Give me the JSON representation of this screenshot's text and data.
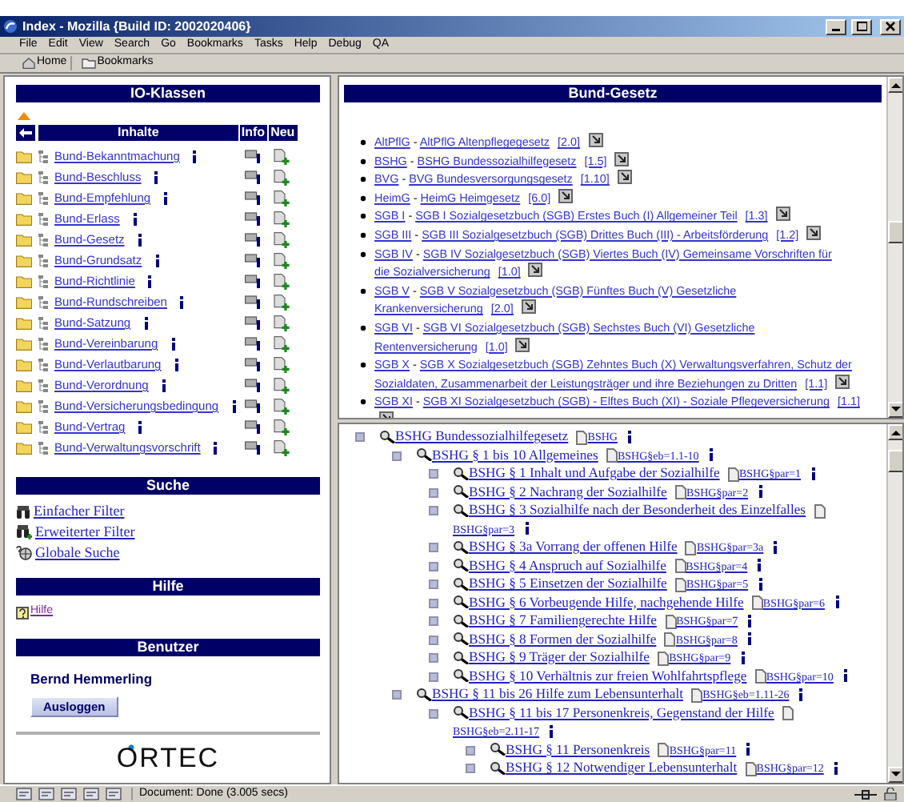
{
  "window": {
    "title": "Index - Mozilla {Build ID: 2002020406}"
  },
  "menu": [
    "File",
    "Edit",
    "View",
    "Search",
    "Go",
    "Bookmarks",
    "Tasks",
    "Help",
    "Debug",
    "QA"
  ],
  "toolbar": [
    "Home",
    "Bookmarks"
  ],
  "io_klassen": {
    "title": "IO-Klassen",
    "columns": [
      "Inhalte",
      "Info",
      "Neu"
    ],
    "rows": [
      {
        "label": "Bund-Bekanntmachung"
      },
      {
        "label": "Bund-Beschluss"
      },
      {
        "label": "Bund-Empfehlung"
      },
      {
        "label": "Bund-Erlass"
      },
      {
        "label": "Bund-Gesetz"
      },
      {
        "label": "Bund-Grundsatz"
      },
      {
        "label": "Bund-Richtlinie"
      },
      {
        "label": "Bund-Rundschreiben"
      },
      {
        "label": "Bund-Satzung"
      },
      {
        "label": "Bund-Vereinbarung"
      },
      {
        "label": "Bund-Verlautbarung"
      },
      {
        "label": "Bund-Verordnung"
      },
      {
        "label": "Bund-Versicherungsbedingung"
      },
      {
        "label": "Bund-Vertrag"
      },
      {
        "label": "Bund-Verwaltungsvorschrift"
      }
    ]
  },
  "suche": {
    "title": "Suche",
    "links": [
      {
        "label": "Einfacher Filter",
        "kind": "binoculars"
      },
      {
        "label": "Erweiterter Filter",
        "kind": "binoculars-plus"
      },
      {
        "label": "Globale Suche",
        "kind": "globe"
      }
    ]
  },
  "hilfe": {
    "title": "Hilfe",
    "links": [
      {
        "label": "Hilfe",
        "visited": true
      }
    ]
  },
  "benutzer": {
    "title": "Benutzer",
    "name": "Bernd Hemmerling",
    "button": "Ausloggen"
  },
  "logo": "ORTEC",
  "bund_gesetz": {
    "title": "Bund-Gesetz",
    "items": [
      {
        "abbr": "AltPflG",
        "dash": "-",
        "name_lines": [
          "AltPflG Altenpflegegesetz"
        ],
        "version": "[2.0]"
      },
      {
        "abbr": "BSHG",
        "dash": "-",
        "name_lines": [
          "BSHG Bundessozialhilfegesetz"
        ],
        "version": "[1.5]"
      },
      {
        "abbr": "BVG",
        "dash": "-",
        "name_lines": [
          "BVG Bundesversorgungsgesetz"
        ],
        "version": "[1.10]"
      },
      {
        "abbr": "HeimG",
        "dash": "-",
        "name_lines": [
          "HeimG Heimgesetz"
        ],
        "version": "[6.0]"
      },
      {
        "abbr": "SGB I",
        "dash": "-",
        "name_lines": [
          "SGB I Sozialgesetzbuch (SGB) Erstes Buch (I) Allgemeiner Teil"
        ],
        "version": "[1.3]"
      },
      {
        "abbr": "SGB III",
        "dash": "-",
        "name_lines": [
          "SGB III Sozialgesetzbuch (SGB) Drittes Buch (III) - Arbeitsförderung"
        ],
        "version": "[1.2]"
      },
      {
        "abbr": "SGB IV",
        "dash": "-",
        "name_lines": [
          "SGB IV Sozialgesetzbuch (SGB) Viertes Buch (IV) Gemeinsame Vorschriften für",
          "die Sozialversicherung"
        ],
        "version": "[1.0]"
      },
      {
        "abbr": "SGB V",
        "dash": "-",
        "name_lines": [
          "SGB V Sozialgesetzbuch (SGB) Fünftes Buch (V) Gesetzliche",
          "Krankenversicherung"
        ],
        "version": "[2.0]"
      },
      {
        "abbr": "SGB VI",
        "dash": "-",
        "name_lines": [
          "SGB VI Sozialgesetzbuch (SGB) Sechstes Buch (VI) Gesetzliche",
          "Rentenversicherung"
        ],
        "version": "[1.0]"
      },
      {
        "abbr": "SGB X",
        "dash": "-",
        "name_lines": [
          "SGB X Sozialgesetzbuch (SGB) Zehntes Buch (X) Verwaltungsverfahren, Schutz der",
          "Sozialdaten, Zusammenarbeit der Leistungsträger und ihre Beziehungen zu Dritten"
        ],
        "version": "[1.1]"
      },
      {
        "abbr": "SGB XI",
        "dash": "-",
        "name_lines": [
          "SGB XI Sozialgesetzbuch (SGB) - Elftes Buch (XI) - Soziale Pflegeversicherung"
        ],
        "version": "[1.1]"
      }
    ]
  },
  "tree": [
    {
      "label": "BSHG Bundessozialhilfegesetz",
      "ref": "BSHG",
      "children": [
        {
          "label": "BSHG § 1 bis 10 Allgemeines",
          "ref": "BSHG§eb=1.1-10",
          "children": [
            {
              "label": "BSHG § 1 Inhalt und Aufgabe der Sozialhilfe",
              "ref": "BSHG§par=1"
            },
            {
              "label": "BSHG § 2 Nachrang der Sozialhilfe",
              "ref": "BSHG§par=2"
            },
            {
              "label": "BSHG § 3 Sozialhilfe nach der Besonderheit des Einzelfalles",
              "ref": "BSHG§par=3"
            },
            {
              "label": "BSHG § 3a Vorrang der offenen Hilfe",
              "ref": "BSHG§par=3a"
            },
            {
              "label": "BSHG § 4 Anspruch auf Sozialhilfe",
              "ref": "BSHG§par=4"
            },
            {
              "label": "BSHG § 5 Einsetzen der Sozialhilfe",
              "ref": "BSHG§par=5"
            },
            {
              "label": "BSHG § 6 Vorbeugende Hilfe, nachgehende Hilfe",
              "ref": "BSHG§par=6"
            },
            {
              "label": "BSHG § 7 Familiengerechte Hilfe",
              "ref": "BSHG§par=7"
            },
            {
              "label": "BSHG § 8 Formen der Sozialhilfe",
              "ref": "BSHG§par=8"
            },
            {
              "label": "BSHG § 9 Träger der Sozialhilfe",
              "ref": "BSHG§par=9"
            },
            {
              "label": "BSHG § 10 Verhältnis zur freien Wohlfahrtspflege",
              "ref": "BSHG§par=10"
            }
          ]
        },
        {
          "label": "BSHG § 11 bis 26 Hilfe zum Lebensunterhalt",
          "ref": "BSHG§eb=1.11-26",
          "children": [
            {
              "label": "BSHG § 11 bis 17 Personenkreis, Gegenstand der Hilfe",
              "ref": "BSHG§eb=2.11-17",
              "children": [
                {
                  "label": "BSHG § 11 Personenkreis",
                  "ref": "BSHG§par=11"
                },
                {
                  "label": "BSHG § 12 Notwendiger Lebensunterhalt",
                  "ref": "BSHG§par=12"
                }
              ]
            }
          ]
        }
      ]
    }
  ],
  "status_bar": {
    "text": "Document: Done (3.005 secs)"
  }
}
